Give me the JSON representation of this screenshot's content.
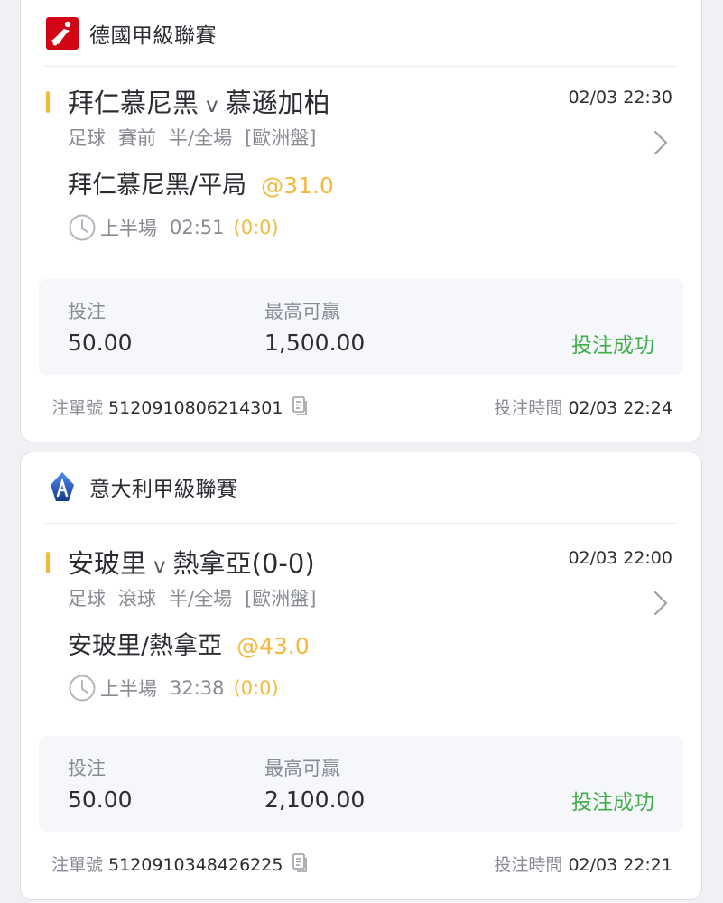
{
  "bets": [
    {
      "league": {
        "name": "德國甲級聯賽",
        "logo_icon": "bundesliga-logo-icon"
      },
      "match": {
        "home": "拜仁慕尼黑",
        "vs": "v",
        "away": "慕遜加柏",
        "time": "02/03 22:30"
      },
      "meta": {
        "sport": "足球",
        "stage": "賽前",
        "market": "半/全場",
        "odds_type": "[歐洲盤]"
      },
      "selection": {
        "pick": "拜仁慕尼黑/平局",
        "odds": "@31.0"
      },
      "period": {
        "half": "上半場",
        "clock": "02:51",
        "score": "(0:0)"
      },
      "stake": {
        "stake_label": "投注",
        "stake_value": "50.00",
        "win_label": "最高可贏",
        "win_value": "1,500.00",
        "status": "投注成功"
      },
      "footer": {
        "ticket_label": "注單號",
        "ticket_no": "5120910806214301",
        "time_label": "投注時間",
        "time_value": "02/03 22:24"
      }
    },
    {
      "league": {
        "name": "意大利甲級聯賽",
        "logo_icon": "serie-a-logo-icon"
      },
      "match": {
        "home": "安玻里",
        "vs": "v",
        "away": "熱拿亞(0-0)",
        "time": "02/03 22:00"
      },
      "meta": {
        "sport": "足球",
        "stage": "滾球",
        "market": "半/全場",
        "odds_type": "[歐洲盤]"
      },
      "selection": {
        "pick": "安玻里/熱拿亞",
        "odds": "@43.0"
      },
      "period": {
        "half": "上半場",
        "clock": "32:38",
        "score": "(0:0)"
      },
      "stake": {
        "stake_label": "投注",
        "stake_value": "50.00",
        "win_label": "最高可贏",
        "win_value": "2,100.00",
        "status": "投注成功"
      },
      "footer": {
        "ticket_label": "注單號",
        "ticket_no": "5120910348426225",
        "time_label": "投注時間",
        "time_value": "02/03 22:21"
      }
    }
  ],
  "colors": {
    "accent": "#f5b83d",
    "success": "#3fae49",
    "muted": "#888b94",
    "text": "#2b2d33"
  }
}
